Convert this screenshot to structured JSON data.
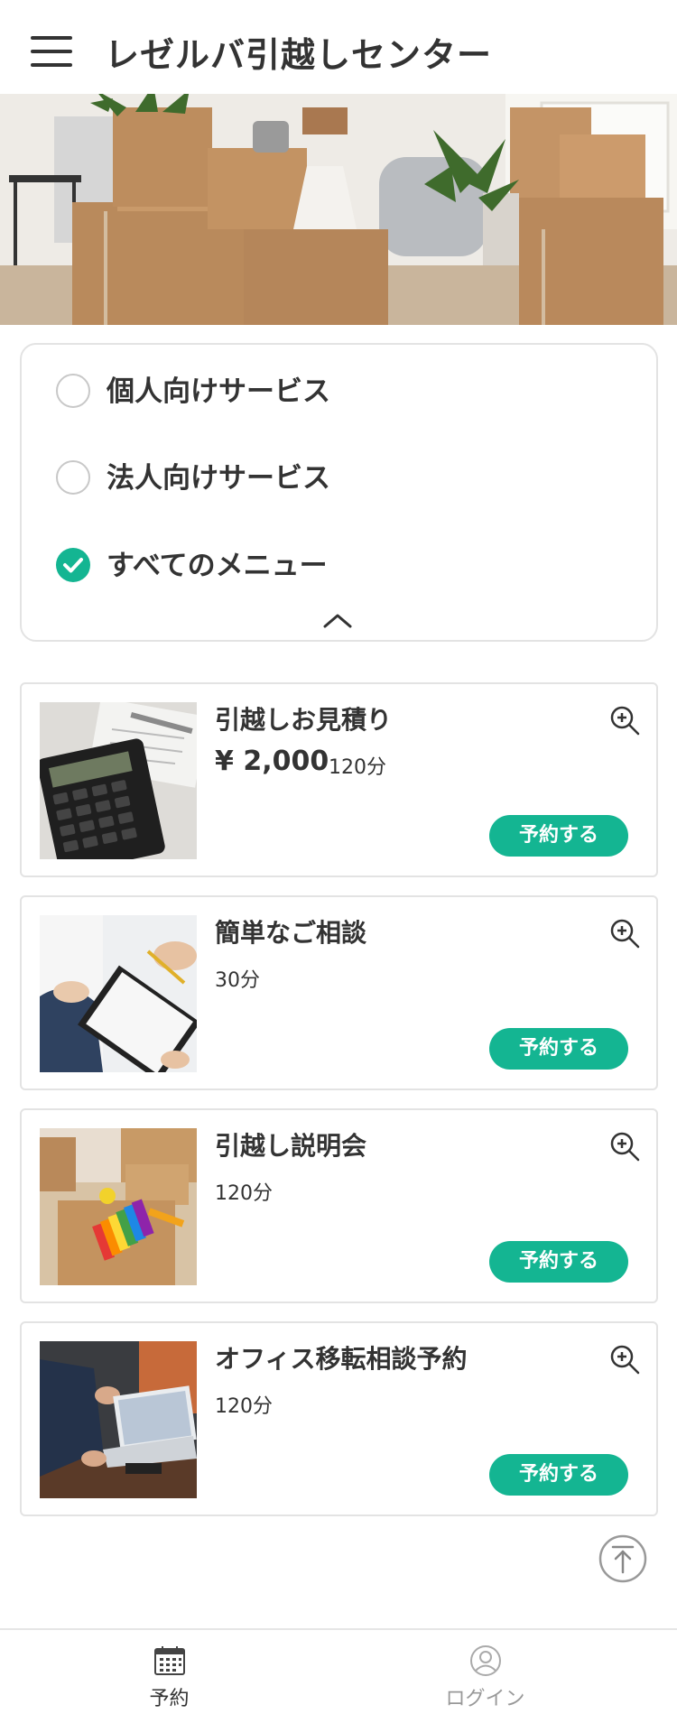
{
  "header": {
    "title": "レゼルバ引越しセンター",
    "menu_icon": "hamburger-menu-icon"
  },
  "hero": {
    "image": "moving-boxes-photo"
  },
  "filters": {
    "options": [
      {
        "label": "個人向けサービス",
        "checked": false
      },
      {
        "label": "法人向けサービス",
        "checked": false
      },
      {
        "label": "すべてのメニュー",
        "checked": true
      }
    ],
    "collapse_icon": "chevron-up-icon"
  },
  "services": [
    {
      "title": "引越しお見積り",
      "price": "¥ 2,000",
      "duration": "120分",
      "button": "予約する",
      "image": "calculator-photo"
    },
    {
      "title": "簡単なご相談",
      "price": "",
      "duration": "30分",
      "button": "予約する",
      "image": "consultation-clipboard-photo"
    },
    {
      "title": "引越し説明会",
      "price": "",
      "duration": "120分",
      "button": "予約する",
      "image": "boxes-color-swatch-photo"
    },
    {
      "title": "オフィス移転相談予約",
      "price": "",
      "duration": "120分",
      "button": "予約する",
      "image": "office-laptop-meeting-photo"
    }
  ],
  "bottom_nav": {
    "items": [
      {
        "label": "予約",
        "icon": "calendar-icon",
        "active": true
      },
      {
        "label": "ログイン",
        "icon": "user-icon",
        "active": false
      }
    ]
  },
  "colors": {
    "accent": "#14b592",
    "text": "#333333",
    "inactive": "#999999",
    "border": "#e3e3e3"
  }
}
